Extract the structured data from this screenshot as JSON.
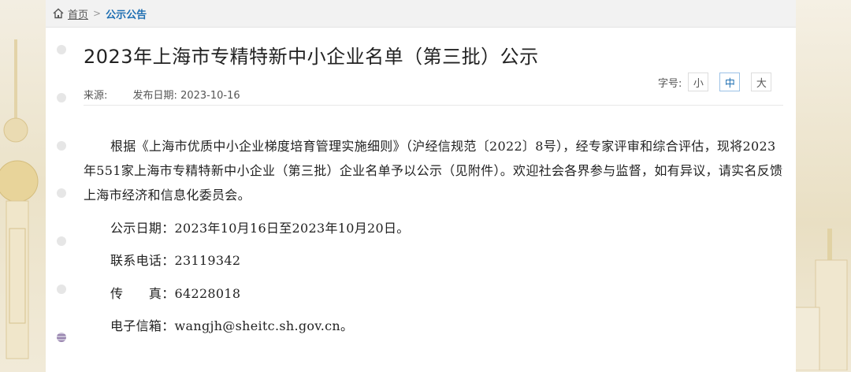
{
  "breadcrumb": {
    "home": "首页",
    "separator": ">",
    "current": "公示公告"
  },
  "article": {
    "title": "2023年上海市专精特新中小企业名单（第三批）公示",
    "source_label": "来源:",
    "source_value": "",
    "date_label": "发布日期:",
    "date_value": "2023-10-16",
    "font_size_label": "字号:",
    "font_size_options": [
      "小",
      "中",
      "大"
    ],
    "font_size_selected": "中",
    "paragraph": "根据《上海市优质中小企业梯度培育管理实施细则》（沪经信规范〔2022〕8号），经专家评审和综合评估，现将2023年551家上海市专精特新中小企业（第三批）企业名单予以公示（见附件）。欢迎社会各界参与监督，如有异议，请实名反馈上海市经济和信息化委员会。",
    "notice_date": "公示日期：2023年10月16日至2023年10月20日。",
    "phone": "联系电话：23119342",
    "fax": "传　　真：64228018",
    "email": "电子信箱：wangjh@sheitc.sh.gov.cn。"
  },
  "colors": {
    "accent": "#1f6fb2",
    "background": "#efe8d6",
    "card": "#ffffff"
  }
}
